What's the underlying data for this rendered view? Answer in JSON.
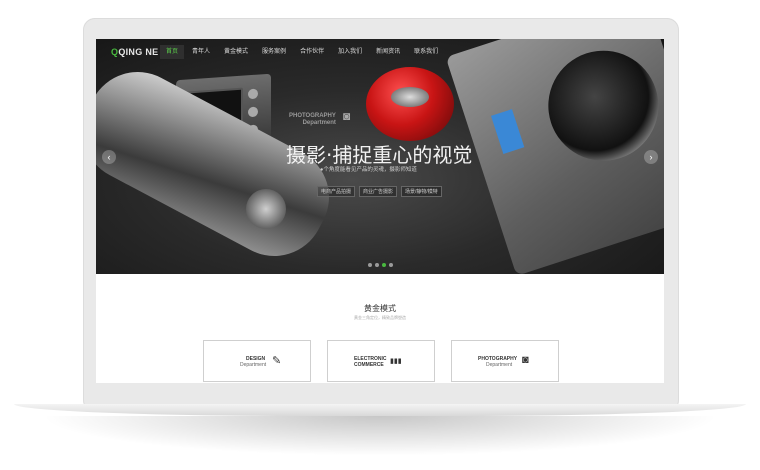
{
  "nav": {
    "logo": "QING NE",
    "items": [
      "首页",
      "青年人",
      "黄金模式",
      "服务案例",
      "合作伙伴",
      "加入我们",
      "新闻资讯",
      "联系我们"
    ],
    "active_index": 0
  },
  "hero": {
    "photo_tag_line1": "PHOTOGRAPHY",
    "photo_tag_line2": "Department",
    "title": "摄影·捕捉重心的视觉",
    "subtitle": "●个角度能看见产品的灵魂，摄影师知道",
    "tags": [
      "电商产品拍摄",
      "商业广告摄影",
      "场景/静物/模特"
    ],
    "arrow_left": "‹",
    "arrow_right": "›",
    "slide_count": 4,
    "active_slide": 2
  },
  "section": {
    "title": "黄金模式",
    "subtitle": "黄金三角定位，精致品牌塑造",
    "cards": [
      {
        "line1": "DESIGN",
        "line2": "Department",
        "icon": "pencil-icon",
        "glyph": "✎"
      },
      {
        "line1": "ELECTRONIC",
        "line2": "COMMERCE",
        "icon": "bar-chart-icon",
        "glyph": "▮▮▮"
      },
      {
        "line1": "PHOTOGRAPHY",
        "line2": "Department",
        "icon": "camera-icon",
        "glyph": "◙"
      }
    ]
  },
  "colors": {
    "accent": "#49b93f",
    "nav_bg": "#2f2f2f"
  }
}
